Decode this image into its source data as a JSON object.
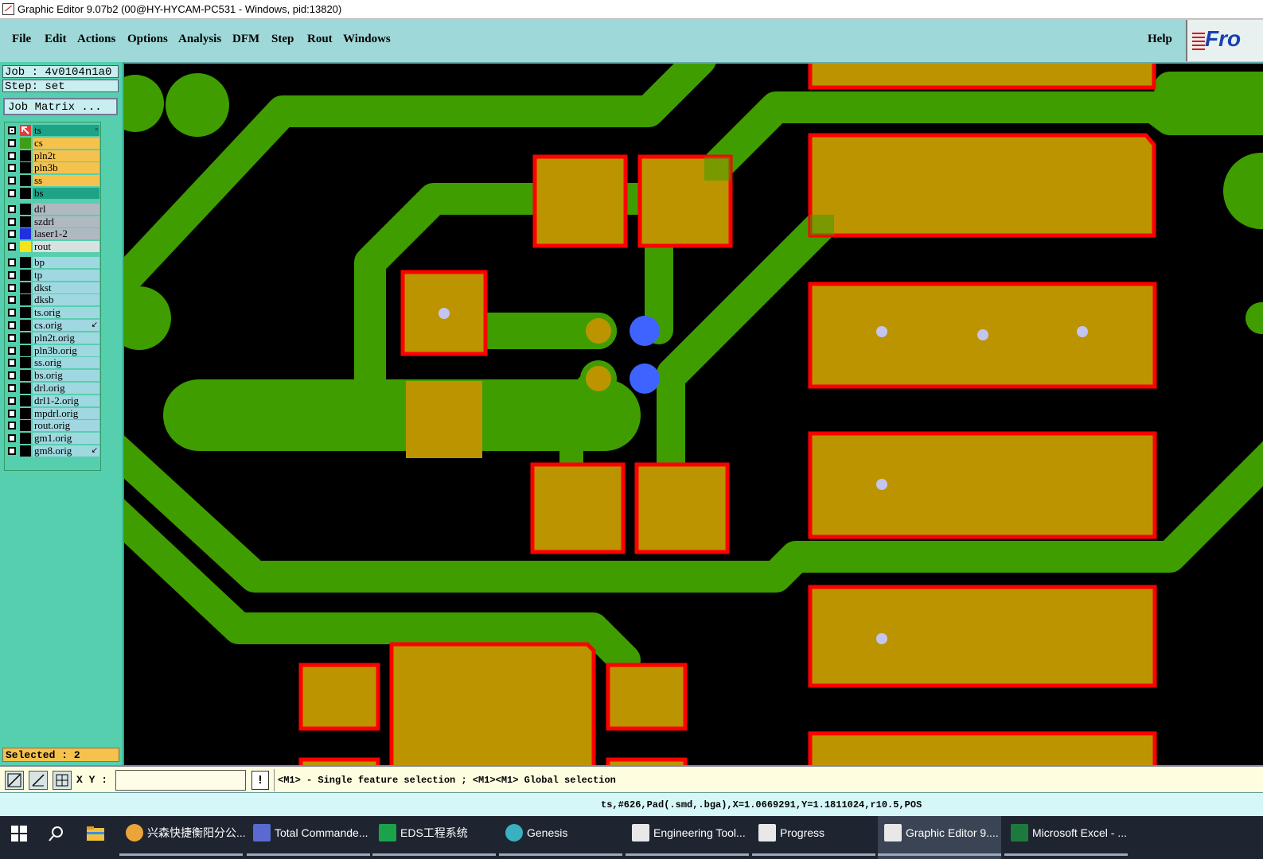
{
  "window": {
    "title": "Graphic Editor 9.07b2 (00@HY-HYCAM-PC531 - Windows, pid:13820)"
  },
  "menu": {
    "items": [
      "File",
      "Edit",
      "Actions",
      "Options",
      "Analysis",
      "DFM",
      "Step",
      "Rout",
      "Windows"
    ],
    "help": "Help"
  },
  "logo": {
    "text": "Fro"
  },
  "job": {
    "job_label": "Job : 4v0104n1a0",
    "step_label": "Step: set",
    "matrix_button": "Job Matrix ..."
  },
  "layers": [
    {
      "name": "ts",
      "color": "#1fa387",
      "swatch": "#e23b3b",
      "icon": "arrow-icon"
    },
    {
      "name": "cs",
      "color": "#f4c24d",
      "swatch": "#3f9d1a"
    },
    {
      "name": "pln2t",
      "color": "#f4c24d",
      "swatch": "#000000"
    },
    {
      "name": "pln3b",
      "color": "#f4c24d",
      "swatch": "#000000"
    },
    {
      "name": "ss",
      "color": "#f4c24d",
      "swatch": "#000000"
    },
    {
      "name": "bs",
      "color": "#1fa387",
      "swatch": "#000000"
    },
    {
      "name": "drl",
      "color": "#b0b8c0",
      "swatch": "#000000"
    },
    {
      "name": "szdrl",
      "color": "#b0b8c0",
      "swatch": "#000000"
    },
    {
      "name": "laser1-2",
      "color": "#b0b8c0",
      "swatch": "#2030e0"
    },
    {
      "name": "rout",
      "color": "#d8e0e0",
      "swatch": "#f4e41c"
    },
    {
      "name": "bp",
      "color": "#9fd8e0",
      "swatch": "#000000"
    },
    {
      "name": "tp",
      "color": "#9fd8e0",
      "swatch": "#000000"
    },
    {
      "name": "dkst",
      "color": "#9fd8e0",
      "swatch": "#000000"
    },
    {
      "name": "dksb",
      "color": "#9fd8e0",
      "swatch": "#000000"
    },
    {
      "name": "ts.orig",
      "color": "#9fd8e0",
      "swatch": "#000000"
    },
    {
      "name": "cs.orig",
      "color": "#9fd8e0",
      "swatch": "#000000"
    },
    {
      "name": "pln2t.orig",
      "color": "#9fd8e0",
      "swatch": "#000000"
    },
    {
      "name": "pln3b.orig",
      "color": "#9fd8e0",
      "swatch": "#000000"
    },
    {
      "name": "ss.orig",
      "color": "#9fd8e0",
      "swatch": "#000000"
    },
    {
      "name": "bs.orig",
      "color": "#9fd8e0",
      "swatch": "#000000"
    },
    {
      "name": "drl.orig",
      "color": "#9fd8e0",
      "swatch": "#000000"
    },
    {
      "name": "drl1-2.orig",
      "color": "#9fd8e0",
      "swatch": "#000000"
    },
    {
      "name": "mpdrl.orig",
      "color": "#9fd8e0",
      "swatch": "#000000"
    },
    {
      "name": "rout.orig",
      "color": "#9fd8e0",
      "swatch": "#000000"
    },
    {
      "name": "gm1.orig",
      "color": "#9fd8e0",
      "swatch": "#000000"
    },
    {
      "name": "gm8.orig",
      "color": "#9fd8e0",
      "swatch": "#000000"
    }
  ],
  "selection": {
    "label": "Selected : 2"
  },
  "coords": {
    "label": "X Y :",
    "value": ""
  },
  "prompt": {
    "text": "<M1> - Single feature selection ; <M1><M1> Global selection",
    "bang": "!"
  },
  "status": {
    "text": "ts,#626,Pad(.smd,.bga),X=1.0669291,Y=1.1811024,r10.5,POS"
  },
  "colors": {
    "trace": "#3f9d00",
    "pad": "#bc9400",
    "outline": "#ff0000",
    "via": "#3f63ff",
    "drill": "#c4c4f0",
    "canvas": "#000000"
  },
  "taskbar": [
    {
      "label": "兴森快捷衡阳分公...",
      "icon": "company-icon"
    },
    {
      "label": "Total Commande...",
      "icon": "floppy-icon"
    },
    {
      "label": "EDS工程系统",
      "icon": "eds-icon"
    },
    {
      "label": "Genesis",
      "icon": "genesis-icon"
    },
    {
      "label": "Engineering Tool...",
      "icon": "frontline-icon"
    },
    {
      "label": "Progress",
      "icon": "frontline-icon"
    },
    {
      "label": "Graphic Editor 9....",
      "icon": "frontline-icon",
      "active": true
    },
    {
      "label": "Microsoft Excel - ...",
      "icon": "excel-icon"
    }
  ]
}
